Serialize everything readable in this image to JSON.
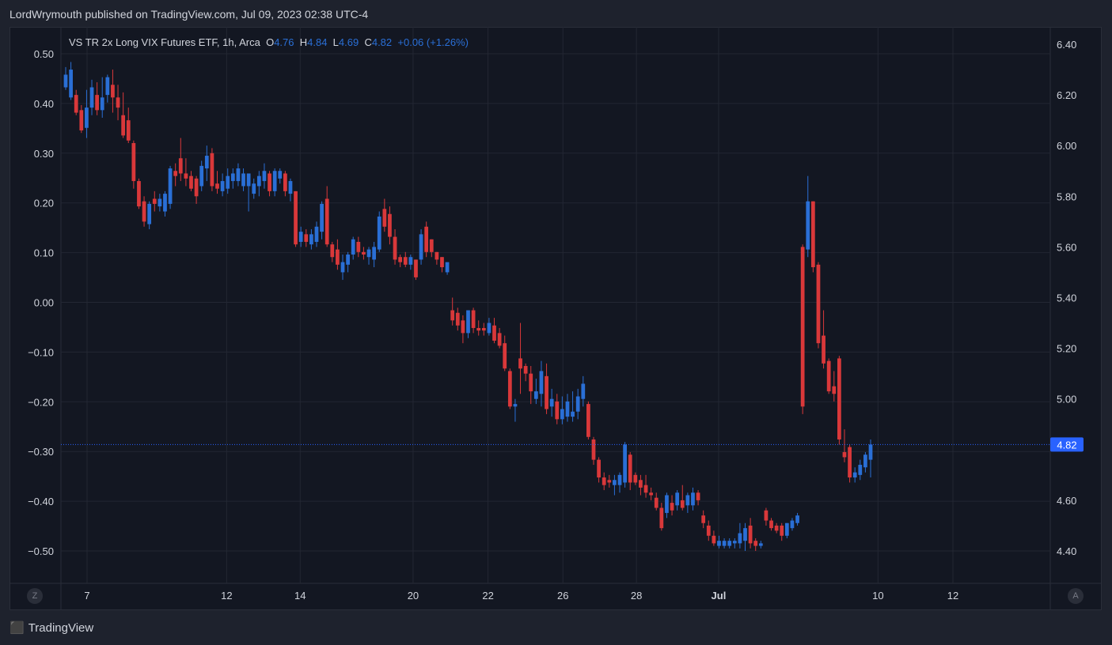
{
  "header": {
    "publisher_line": "LordWrymouth published on TradingView.com, Jul 09, 2023 02:38 UTC-4"
  },
  "legend": {
    "symbol": "VS TR 2x Long VIX Futures ETF, 1h, Arca",
    "o_label": "O",
    "o_value": "4.76",
    "h_label": "H",
    "h_value": "4.84",
    "l_label": "L",
    "l_value": "4.69",
    "c_label": "C",
    "c_value": "4.82",
    "change": "+0.06 (+1.26%)"
  },
  "footer": {
    "brand": "TradingView"
  },
  "badges": {
    "left": "Z",
    "right": "A"
  },
  "colors": {
    "up": "#2a6fd6",
    "down": "#d9383a",
    "price_tag": "#2962ff"
  },
  "chart_data": {
    "type": "candlestick",
    "left_axis": {
      "ticks": [
        "0.50",
        "0.40",
        "0.30",
        "0.20",
        "0.10",
        "0.00",
        "−0.10",
        "−0.20",
        "−0.30",
        "−0.40",
        "−0.50"
      ],
      "range": [
        -0.5,
        0.5
      ]
    },
    "right_axis": {
      "ticks": [
        "6.40",
        "6.20",
        "6.00",
        "5.80",
        "5.60",
        "5.40",
        "5.20",
        "5.00",
        "4.60",
        "4.40"
      ],
      "range": [
        4.4,
        6.4
      ]
    },
    "x_ticks": [
      {
        "label": "7",
        "pos": 0.0
      },
      {
        "label": "12",
        "pos": 0.1429
      },
      {
        "label": "14",
        "pos": 0.2182
      },
      {
        "label": "20",
        "pos": 0.3338
      },
      {
        "label": "22",
        "pos": 0.4105
      },
      {
        "label": "26",
        "pos": 0.4872
      },
      {
        "label": "28",
        "pos": 0.5625
      },
      {
        "label": "Jul",
        "pos": 0.6466
      },
      {
        "label": "10",
        "pos": 0.8098
      },
      {
        "label": "12",
        "pos": 0.8865
      }
    ],
    "last_price": 4.82,
    "candles": [
      [
        6.27,
        6.28,
        6.23,
        6.22,
        6.31
      ],
      [
        6.25,
        6.3,
        6.19,
        6.18,
        6.33
      ],
      [
        6.2,
        6.2,
        6.13,
        6.12,
        6.22
      ],
      [
        6.14,
        6.14,
        6.06,
        6.05,
        6.16
      ],
      [
        6.08,
        6.15,
        6.07,
        6.03,
        6.22
      ],
      [
        6.15,
        6.23,
        6.15,
        6.12,
        6.26
      ],
      [
        6.2,
        6.2,
        6.14,
        6.12,
        6.25
      ],
      [
        6.14,
        6.19,
        6.14,
        6.11,
        6.27
      ],
      [
        6.2,
        6.27,
        6.2,
        6.17,
        6.28
      ],
      [
        6.24,
        6.24,
        6.19,
        6.13,
        6.3
      ],
      [
        6.19,
        6.19,
        6.15,
        6.1,
        6.24
      ],
      [
        6.12,
        6.12,
        6.04,
        6.03,
        6.21
      ],
      [
        6.1,
        6.1,
        6.02,
        6.01,
        6.15
      ],
      [
        6.01,
        6.01,
        5.86,
        5.83,
        6.02
      ],
      [
        5.86,
        5.86,
        5.76,
        5.75,
        5.87
      ],
      [
        5.78,
        5.78,
        5.7,
        5.68,
        5.8
      ],
      [
        5.69,
        5.77,
        5.69,
        5.67,
        5.78
      ],
      [
        5.79,
        5.79,
        5.77,
        5.74,
        5.82
      ],
      [
        5.76,
        5.79,
        5.76,
        5.74,
        5.81
      ],
      [
        5.75,
        5.81,
        5.74,
        5.72,
        5.82
      ],
      [
        5.77,
        5.91,
        5.77,
        5.75,
        5.92
      ],
      [
        5.9,
        5.9,
        5.88,
        5.84,
        5.93
      ],
      [
        5.95,
        5.95,
        5.89,
        5.86,
        6.03
      ],
      [
        5.89,
        5.89,
        5.87,
        5.84,
        5.95
      ],
      [
        5.88,
        5.88,
        5.83,
        5.82,
        5.9
      ],
      [
        5.87,
        5.87,
        5.8,
        5.77,
        5.88
      ],
      [
        5.85,
        5.92,
        5.84,
        5.82,
        5.94
      ],
      [
        5.92,
        5.96,
        5.91,
        5.86,
        6.0
      ],
      [
        5.97,
        5.97,
        5.84,
        5.82,
        5.99
      ],
      [
        5.85,
        5.85,
        5.83,
        5.81,
        5.9
      ],
      [
        5.84,
        5.86,
        5.82,
        5.8,
        5.89
      ],
      [
        5.85,
        5.88,
        5.83,
        5.81,
        5.91
      ],
      [
        5.87,
        5.89,
        5.86,
        5.83,
        5.91
      ],
      [
        5.87,
        5.91,
        5.86,
        5.84,
        5.93
      ],
      [
        5.85,
        5.89,
        5.84,
        5.82,
        5.91
      ],
      [
        5.84,
        5.89,
        5.84,
        5.74,
        5.88
      ],
      [
        5.83,
        5.85,
        5.81,
        5.79,
        5.87
      ],
      [
        5.84,
        5.88,
        5.84,
        5.8,
        5.9
      ],
      [
        5.86,
        5.9,
        5.86,
        5.83,
        5.93
      ],
      [
        5.89,
        5.89,
        5.82,
        5.8,
        5.9
      ],
      [
        5.82,
        5.9,
        5.82,
        5.8,
        5.91
      ],
      [
        5.88,
        5.9,
        5.87,
        5.85,
        5.91
      ],
      [
        5.89,
        5.89,
        5.82,
        5.8,
        5.9
      ],
      [
        5.82,
        5.86,
        5.81,
        5.78,
        5.87
      ],
      [
        5.82,
        5.82,
        5.61,
        5.6,
        5.82
      ],
      [
        5.63,
        5.66,
        5.62,
        5.6,
        5.68
      ],
      [
        5.65,
        5.65,
        5.62,
        5.6,
        5.67
      ],
      [
        5.62,
        5.65,
        5.61,
        5.59,
        5.67
      ],
      [
        5.62,
        5.68,
        5.62,
        5.6,
        5.7
      ],
      [
        5.66,
        5.77,
        5.66,
        5.63,
        5.78
      ],
      [
        5.79,
        5.79,
        5.61,
        5.6,
        5.84
      ],
      [
        5.61,
        5.61,
        5.56,
        5.54,
        5.62
      ],
      [
        5.59,
        5.59,
        5.53,
        5.51,
        5.63
      ],
      [
        5.5,
        5.54,
        5.5,
        5.47,
        5.57
      ],
      [
        5.53,
        5.57,
        5.53,
        5.5,
        5.58
      ],
      [
        5.57,
        5.63,
        5.57,
        5.55,
        5.64
      ],
      [
        5.62,
        5.62,
        5.58,
        5.56,
        5.64
      ],
      [
        5.58,
        5.58,
        5.57,
        5.55,
        5.6
      ],
      [
        5.57,
        5.59,
        5.56,
        5.53,
        5.6
      ],
      [
        5.58,
        5.6,
        5.55,
        5.52,
        5.62
      ],
      [
        5.6,
        5.72,
        5.59,
        5.58,
        5.74
      ],
      [
        5.75,
        5.75,
        5.68,
        5.66,
        5.79
      ],
      [
        5.73,
        5.73,
        5.64,
        5.61,
        5.76
      ],
      [
        5.64,
        5.64,
        5.55,
        5.53,
        5.67
      ],
      [
        5.56,
        5.56,
        5.54,
        5.52,
        5.57
      ],
      [
        5.56,
        5.56,
        5.53,
        5.52,
        5.58
      ],
      [
        5.55,
        5.56,
        5.53,
        5.51,
        5.57
      ],
      [
        5.55,
        5.55,
        5.48,
        5.47,
        5.55
      ],
      [
        5.55,
        5.65,
        5.55,
        5.53,
        5.67
      ],
      [
        5.68,
        5.68,
        5.58,
        5.56,
        5.7
      ],
      [
        5.63,
        5.63,
        5.58,
        5.56,
        5.63
      ],
      [
        5.58,
        5.58,
        5.55,
        5.53,
        5.58
      ],
      [
        5.56,
        5.56,
        5.52,
        5.5,
        5.56
      ],
      [
        5.52,
        5.54,
        5.5,
        5.49,
        5.53
      ],
      [
        5.35,
        5.35,
        5.31,
        5.29,
        5.4
      ],
      [
        5.34,
        5.34,
        5.29,
        5.27,
        5.36
      ],
      [
        5.31,
        5.31,
        5.26,
        5.22,
        5.33
      ],
      [
        5.26,
        5.35,
        5.26,
        5.24,
        5.35
      ],
      [
        5.35,
        5.35,
        5.28,
        5.26,
        5.36
      ],
      [
        5.28,
        5.28,
        5.27,
        5.25,
        5.31
      ],
      [
        5.28,
        5.28,
        5.27,
        5.25,
        5.3
      ],
      [
        5.27,
        5.3,
        5.26,
        5.25,
        5.32
      ],
      [
        5.29,
        5.29,
        5.23,
        5.22,
        5.32
      ],
      [
        5.26,
        5.26,
        5.21,
        5.2,
        5.28
      ],
      [
        5.22,
        5.22,
        5.12,
        5.11,
        5.25
      ],
      [
        5.11,
        5.11,
        4.97,
        4.96,
        5.12
      ],
      [
        4.97,
        4.98,
        4.97,
        4.91,
        5.0
      ],
      [
        5.16,
        5.16,
        5.12,
        5.02,
        5.3
      ],
      [
        5.13,
        5.13,
        5.1,
        5.07,
        5.14
      ],
      [
        5.1,
        5.1,
        5.03,
        4.98,
        5.13
      ],
      [
        5.01,
        5.03,
        5.0,
        4.98,
        5.08
      ],
      [
        5.02,
        5.11,
        5.02,
        4.97,
        5.15
      ],
      [
        5.09,
        5.09,
        4.96,
        4.94,
        5.14
      ],
      [
        4.97,
        5.0,
        4.97,
        4.93,
        5.04
      ],
      [
        4.99,
        4.99,
        4.92,
        4.9,
        5.02
      ],
      [
        4.93,
        4.96,
        4.92,
        4.9,
        5.01
      ],
      [
        4.93,
        4.99,
        4.93,
        4.91,
        5.02
      ],
      [
        4.94,
        4.95,
        4.93,
        4.91,
        5.03
      ],
      [
        4.95,
        5.01,
        4.95,
        4.92,
        5.04
      ],
      [
        5.0,
        5.06,
        5.0,
        4.97,
        5.09
      ],
      [
        4.98,
        4.98,
        4.85,
        4.84,
        4.99
      ],
      [
        4.84,
        4.84,
        4.76,
        4.74,
        4.85
      ],
      [
        4.76,
        4.76,
        4.69,
        4.67,
        4.77
      ],
      [
        4.69,
        4.69,
        4.66,
        4.64,
        4.71
      ],
      [
        4.68,
        4.68,
        4.67,
        4.65,
        4.7
      ],
      [
        4.66,
        4.68,
        4.66,
        4.62,
        4.7
      ],
      [
        4.66,
        4.7,
        4.66,
        4.63,
        4.71
      ],
      [
        4.68,
        4.82,
        4.67,
        4.65,
        4.83
      ],
      [
        4.78,
        4.78,
        4.67,
        4.64,
        4.79
      ],
      [
        4.7,
        4.7,
        4.67,
        4.66,
        4.71
      ],
      [
        4.68,
        4.68,
        4.65,
        4.62,
        4.7
      ],
      [
        4.66,
        4.66,
        4.63,
        4.61,
        4.7
      ],
      [
        4.63,
        4.63,
        4.62,
        4.6,
        4.65
      ],
      [
        4.61,
        4.61,
        4.57,
        4.56,
        4.63
      ],
      [
        4.57,
        4.57,
        4.49,
        4.48,
        4.59
      ],
      [
        4.56,
        4.62,
        4.55,
        4.53,
        4.63
      ],
      [
        4.59,
        4.59,
        4.56,
        4.54,
        4.62
      ],
      [
        4.59,
        4.63,
        4.58,
        4.56,
        4.64
      ],
      [
        4.6,
        4.6,
        4.57,
        4.56,
        4.66
      ],
      [
        4.58,
        4.62,
        4.58,
        4.55,
        4.63
      ],
      [
        4.58,
        4.63,
        4.58,
        4.56,
        4.65
      ],
      [
        4.63,
        4.63,
        4.6,
        4.58,
        4.64
      ],
      [
        4.54,
        4.54,
        4.51,
        4.49,
        4.56
      ],
      [
        4.5,
        4.5,
        4.46,
        4.44,
        4.52
      ],
      [
        4.46,
        4.46,
        4.43,
        4.42,
        4.48
      ],
      [
        4.42,
        4.44,
        4.42,
        4.41,
        4.46
      ],
      [
        4.43,
        4.44,
        4.42,
        4.41,
        4.45
      ],
      [
        4.42,
        4.44,
        4.42,
        4.41,
        4.45
      ],
      [
        4.43,
        4.44,
        4.43,
        4.41,
        4.45
      ],
      [
        4.43,
        4.47,
        4.43,
        4.41,
        4.51
      ],
      [
        4.44,
        4.49,
        4.44,
        4.4,
        4.51
      ],
      [
        4.5,
        4.5,
        4.43,
        4.41,
        4.53
      ],
      [
        4.44,
        4.44,
        4.42,
        4.4,
        4.45
      ],
      [
        4.42,
        4.43,
        4.42,
        4.41,
        4.44
      ],
      [
        4.56,
        4.56,
        4.52,
        4.5,
        4.57
      ],
      [
        4.52,
        4.52,
        4.49,
        4.48,
        4.53
      ],
      [
        4.5,
        4.5,
        4.48,
        4.47,
        4.51
      ],
      [
        4.5,
        4.5,
        4.46,
        4.44,
        4.51
      ],
      [
        4.46,
        4.51,
        4.46,
        4.45,
        4.51
      ],
      [
        4.5,
        4.52,
        4.49,
        4.48,
        4.53
      ],
      [
        4.51,
        4.54,
        4.51,
        4.5,
        4.55
      ],
      [
        5.6,
        5.6,
        4.97,
        4.94,
        5.61
      ],
      [
        5.59,
        5.78,
        5.59,
        5.56,
        5.88
      ],
      [
        5.78,
        5.78,
        5.52,
        5.5,
        5.78
      ],
      [
        5.53,
        5.53,
        5.22,
        5.2,
        5.54
      ],
      [
        5.25,
        5.25,
        5.14,
        5.12,
        5.35
      ],
      [
        5.15,
        5.15,
        5.03,
        5.02,
        5.16
      ],
      [
        5.05,
        5.05,
        5.02,
        4.99,
        5.11
      ],
      [
        5.16,
        5.16,
        4.84,
        4.82,
        5.17
      ],
      [
        4.79,
        4.79,
        4.77,
        4.75,
        4.88
      ],
      [
        4.81,
        4.81,
        4.69,
        4.67,
        4.82
      ],
      [
        4.69,
        4.71,
        4.69,
        4.67,
        4.73
      ],
      [
        4.7,
        4.74,
        4.7,
        4.68,
        4.76
      ],
      [
        4.73,
        4.78,
        4.73,
        4.71,
        4.79
      ],
      [
        4.76,
        4.82,
        4.76,
        4.69,
        4.84
      ]
    ]
  }
}
